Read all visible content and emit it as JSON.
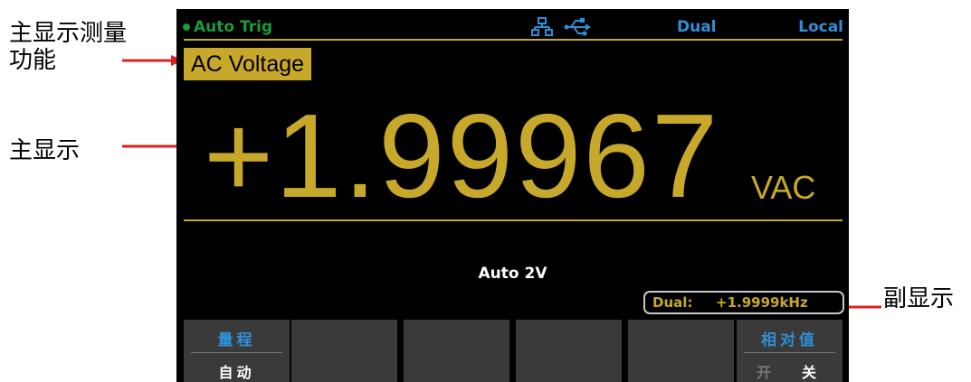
{
  "annotations": {
    "function_label": "主显示测量功能",
    "main_label": "主显示",
    "sub_label": "副显示"
  },
  "status": {
    "trigger": "Auto  Trig",
    "mode": "Dual",
    "remote": "Local",
    "icons": [
      "lan-icon",
      "usb-icon"
    ]
  },
  "function": {
    "name": "AC Voltage"
  },
  "main_display": {
    "value": "+1.99967",
    "unit": "VAC"
  },
  "range": {
    "text": "Auto  2V"
  },
  "sub_display": {
    "label": "Dual:",
    "value": "+1.9999kHz"
  },
  "softkeys": [
    {
      "title": "量程",
      "sub": "自动"
    },
    {
      "title": "",
      "sub": ""
    },
    {
      "title": "",
      "sub": ""
    },
    {
      "title": "",
      "sub": ""
    },
    {
      "title": "",
      "sub": ""
    },
    {
      "title": "相对值",
      "options": [
        "开",
        "关"
      ]
    }
  ],
  "colors": {
    "accent": "#c8a82a",
    "status_blue": "#2e8fd6",
    "status_green": "#1a9c3a",
    "annotation_arrow": "#e02020"
  }
}
